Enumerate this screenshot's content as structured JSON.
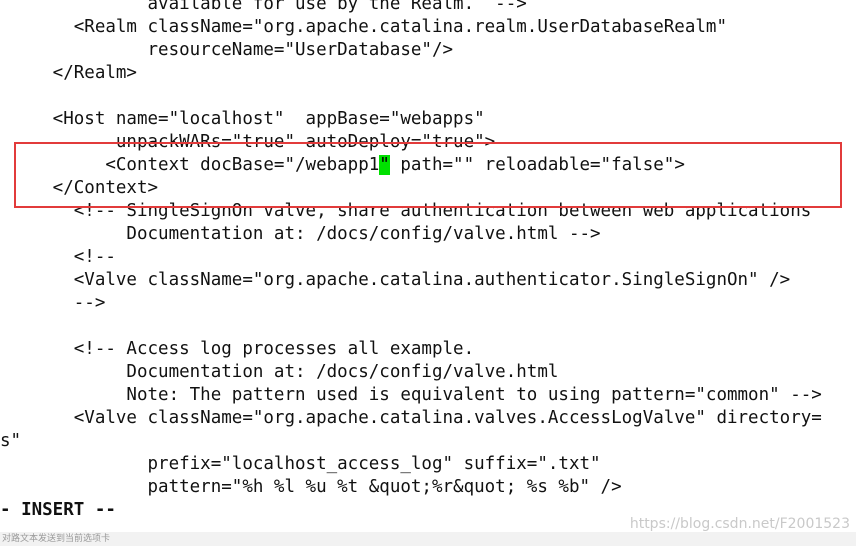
{
  "editor": {
    "lines": [
      "              available for use by the Realm.  -->",
      "       <Realm className=\"org.apache.catalina.realm.UserDatabaseRealm\"",
      "              resourceName=\"UserDatabase\"/>",
      "     </Realm>",
      "",
      "     <Host name=\"localhost\"  appBase=\"webapps\"",
      "           unpackWARs=\"true\" autoDeploy=\"true\">",
      "          <Context docBase=\"/webapp1",
      "     </Context>",
      "       <!-- SingleSignOn valve, share authentication between web applications",
      "            Documentation at: /docs/config/valve.html -->",
      "       <!--",
      "       <Valve className=\"org.apache.catalina.authenticator.SingleSignOn\" />",
      "       -->",
      "",
      "       <!-- Access log processes all example.",
      "            Documentation at: /docs/config/valve.html",
      "            Note: The pattern used is equivalent to using pattern=\"common\" -->",
      "       <Valve className=\"org.apache.catalina.valves.AccessLogValve\" directory=",
      "s\"",
      "              prefix=\"localhost_access_log\" suffix=\".txt\"",
      "              pattern=\"%h %l %u %t &quot;%r&quot; %s %b\" />"
    ],
    "cursor_line": {
      "before": "          <Context docBase=\"/webapp1",
      "cursor_char": "\"",
      "after": " path=\"\" reloadable=\"false\">"
    },
    "mode_text": "- INSERT --"
  },
  "status_bar": {
    "text": "对路文本发送到当前选项卡"
  },
  "watermark": {
    "text": "https://blog.csdn.net/F2001523"
  },
  "colors": {
    "cursor": "#00e000",
    "highlight_box": "#e23b3b",
    "text": "#111111",
    "background": "#ffffff"
  }
}
